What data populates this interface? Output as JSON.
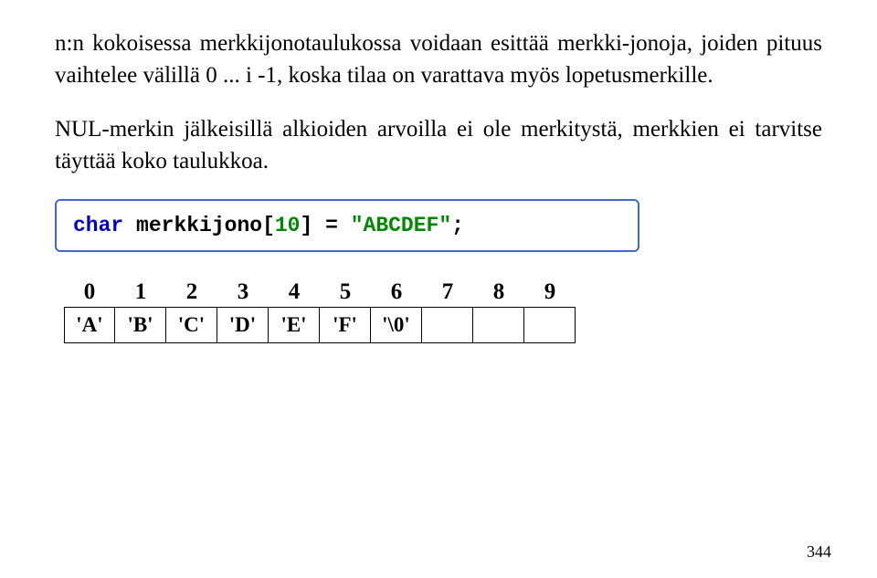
{
  "paragraph1_part1": "n:n kokoisessa merkkijonotaulukossa voidaan esittää merkki-jonoja, joiden pituus vaihtelee välillä 0 ... i -1, ",
  "paragraph1_part2": "koska tilaa on varattava myös lopetusmerkille.",
  "paragraph2": "NUL-merkin jälkeisillä alkioiden arvoilla ei ole merkitystä, merkkien ei tarvitse täyttää koko taulukkoa.",
  "code": {
    "type": "char",
    "name": "merkkijono",
    "dim_open": "[",
    "dim_size": "10",
    "dim_close": "]",
    "assign": " = ",
    "value": "\"ABCDEF\"",
    "semicolon": ";"
  },
  "indices": [
    "0",
    "1",
    "2",
    "3",
    "4",
    "5",
    "6",
    "7",
    "8",
    "9"
  ],
  "cells": [
    "'A'",
    "'B'",
    "'C'",
    "'D'",
    "'E'",
    "'F'",
    "'\\0'",
    "",
    "",
    ""
  ],
  "page_number": "344"
}
